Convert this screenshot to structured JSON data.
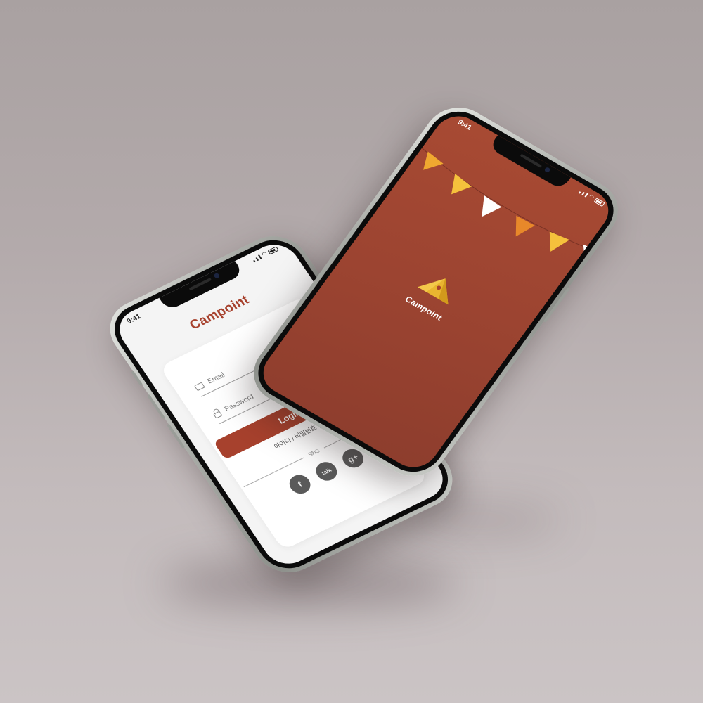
{
  "colors": {
    "brand": "#a7412d",
    "splash_bg": "#9c4431",
    "bunting": [
      "#f0a830",
      "#f5c13c",
      "#ffffff",
      "#e8882a",
      "#f5c13c",
      "#ffffff"
    ]
  },
  "login_phone": {
    "status_time": "9:41",
    "app_name": "Campoint",
    "email_placeholder": "Email",
    "password_placeholder": "Password",
    "login_button": "Login",
    "find_link": "아이디 / 비밀번호 찾기",
    "sns_label": "SNS",
    "sns_icons": [
      {
        "name": "facebook-icon",
        "glyph": "f"
      },
      {
        "name": "kakao-talk-icon",
        "glyph": "talk"
      },
      {
        "name": "google-plus-icon",
        "glyph": "g+"
      }
    ]
  },
  "splash_phone": {
    "status_time": "9:41",
    "app_name": "Campoint"
  }
}
